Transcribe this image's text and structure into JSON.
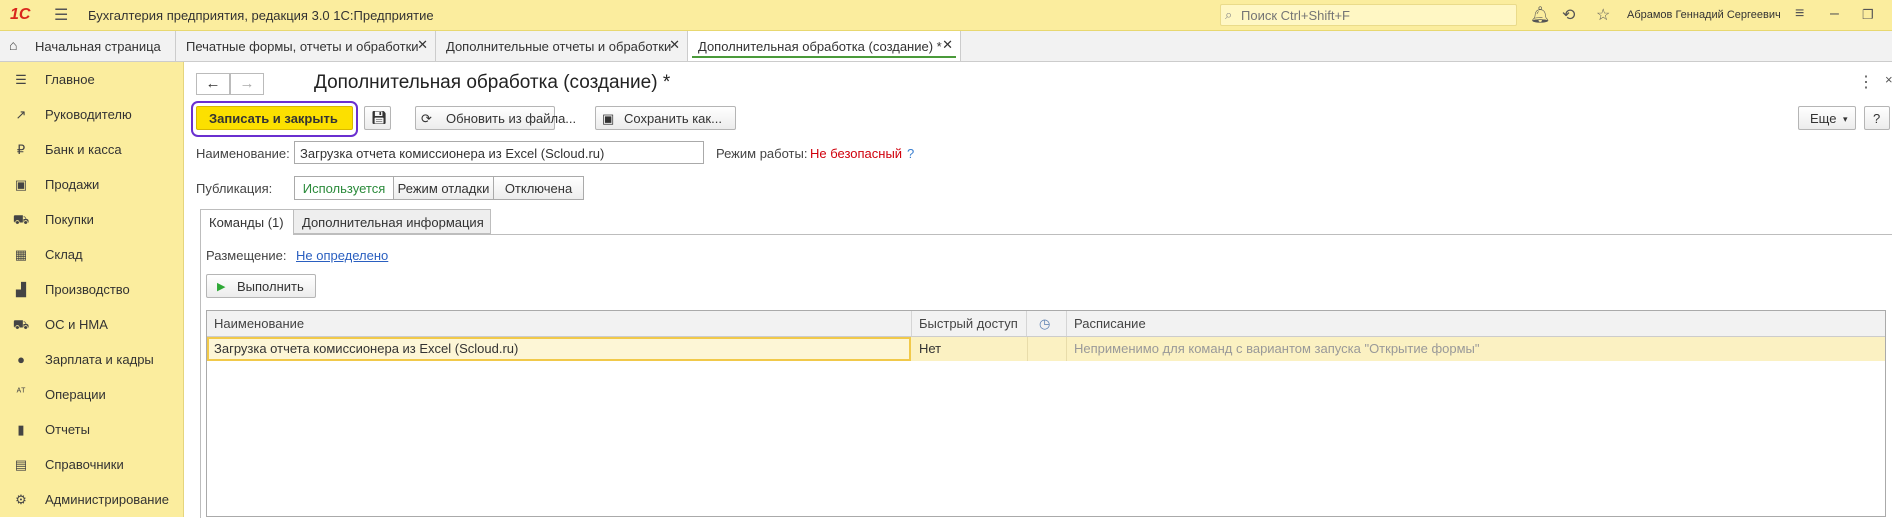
{
  "app": {
    "logo": "1С",
    "title": "Бухгалтерия предприятия, редакция 3.0 1С:Предприятие",
    "search_placeholder": "Поиск Ctrl+Shift+F",
    "user": "Абрамов Геннадий Сергеевич"
  },
  "tabs": {
    "home": "Начальная страница",
    "items": [
      {
        "label": "Печатные формы, отчеты и обработки"
      },
      {
        "label": "Дополнительные отчеты и обработки"
      },
      {
        "label": "Дополнительная обработка (создание) *"
      }
    ]
  },
  "sidebar": {
    "items": [
      {
        "label": "Главное"
      },
      {
        "label": "Руководителю"
      },
      {
        "label": "Банк и касса"
      },
      {
        "label": "Продажи"
      },
      {
        "label": "Покупки"
      },
      {
        "label": "Склад"
      },
      {
        "label": "Производство"
      },
      {
        "label": "ОС и НМА"
      },
      {
        "label": "Зарплата и кадры"
      },
      {
        "label": "Операции"
      },
      {
        "label": "Отчеты"
      },
      {
        "label": "Справочники"
      },
      {
        "label": "Администрирование"
      }
    ]
  },
  "form": {
    "title": "Дополнительная обработка (создание) *",
    "toolbar": {
      "save_close": "Записать и закрыть",
      "update_from_file": "Обновить из файла...",
      "save_as": "Сохранить как...",
      "more": "Еще",
      "help": "?"
    },
    "name_label": "Наименование:",
    "name_value": "Загрузка отчета комиссионера из Excel (Scloud.ru)",
    "mode_label": "Режим работы:",
    "mode_value": "Не безопасный",
    "mode_help": "?",
    "publication_label": "Публикация:",
    "publication_options": [
      "Используется",
      "Режим отладки",
      "Отключена"
    ],
    "inner_tabs": [
      "Команды (1)",
      "Дополнительная информация"
    ],
    "placement_label": "Размещение:",
    "placement_value": "Не определено",
    "execute_button": "Выполнить",
    "table": {
      "columns": [
        "Наименование",
        "Быстрый доступ",
        "Расписание"
      ],
      "rows": [
        {
          "name": "Загрузка отчета комиссионера из Excel (Scloud.ru)",
          "quick_access": "Нет",
          "schedule": "Неприменимо для команд с вариантом запуска \"Открытие формы\""
        }
      ]
    }
  }
}
